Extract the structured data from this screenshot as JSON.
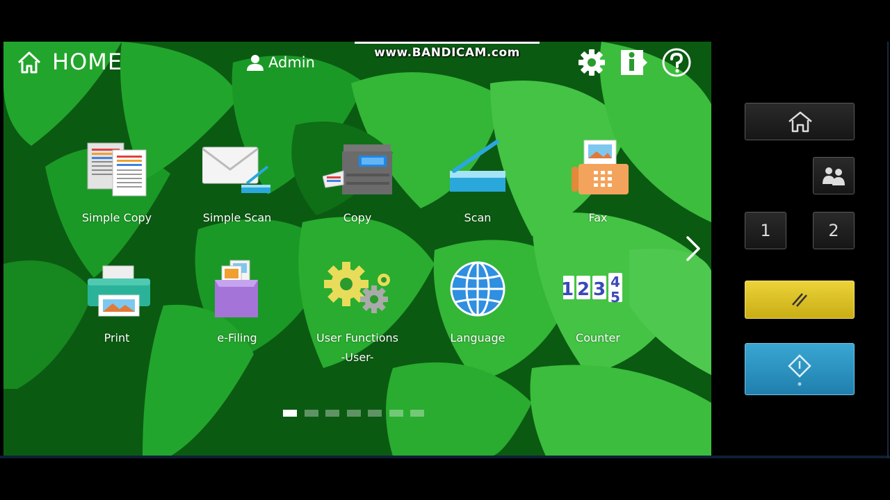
{
  "header": {
    "home_title": "HOME",
    "user_label": "Admin",
    "watermark": "www.BANDICAM.com"
  },
  "apps": [
    {
      "label": "Simple Copy",
      "icon": "simple-copy-icon"
    },
    {
      "label": "Simple Scan",
      "icon": "simple-scan-icon"
    },
    {
      "label": "Copy",
      "icon": "copy-icon"
    },
    {
      "label": "Scan",
      "icon": "scan-icon"
    },
    {
      "label": "Fax",
      "icon": "fax-icon"
    },
    {
      "label": "Print",
      "icon": "print-icon"
    },
    {
      "label": "e-Filing",
      "icon": "e-filing-icon"
    },
    {
      "label": "User Functions",
      "label2": "-User-",
      "icon": "user-functions-icon"
    },
    {
      "label": "Language",
      "icon": "language-icon"
    },
    {
      "label": "Counter",
      "icon": "counter-icon",
      "digits": [
        "1",
        "2",
        "3",
        "4",
        "5"
      ]
    }
  ],
  "pager": {
    "total": 7,
    "active": 1
  },
  "hardware": {
    "home_icon": "home-icon",
    "user_icon": "user-switch-icon",
    "key1": "1",
    "key2": "2",
    "clear_icon": "clear-icon",
    "start_icon": "start-icon"
  },
  "colors": {
    "bg_dark": "#0b5a12",
    "bg_green": "#1ea52a",
    "bg_light": "#4fd64f",
    "clear_button": "#e0c62a",
    "start_button": "#2f98c6"
  }
}
